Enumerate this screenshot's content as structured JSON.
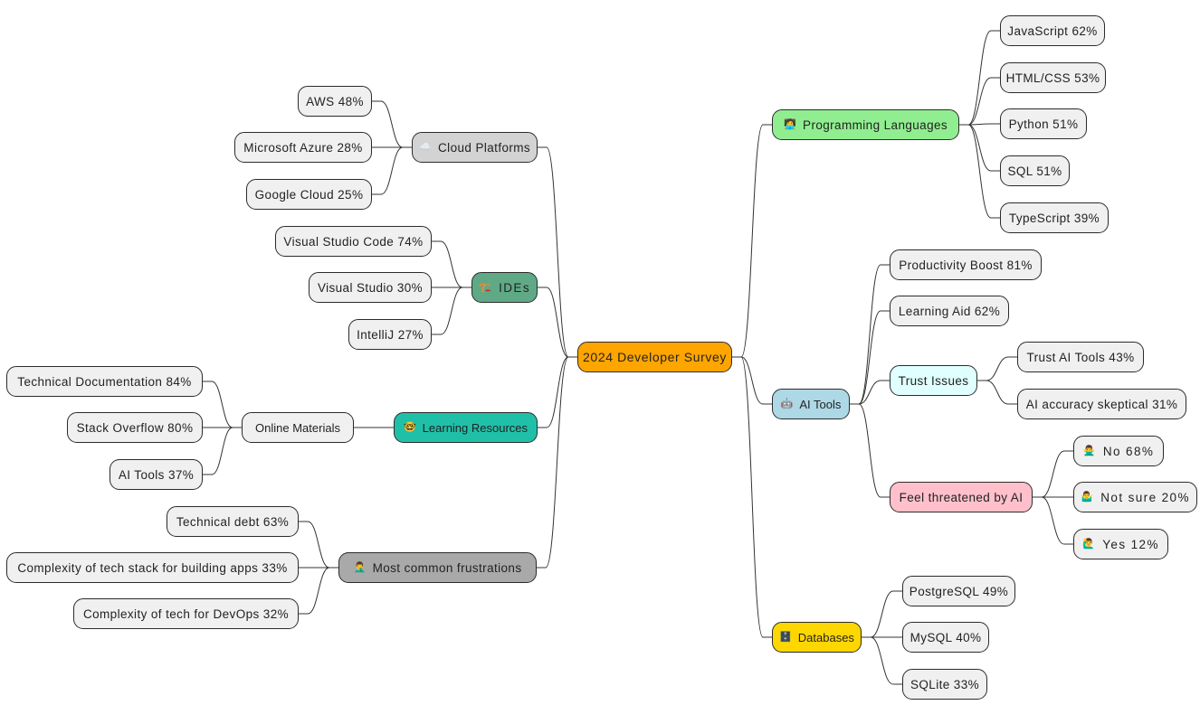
{
  "title": "2024 Developer Survey",
  "colors": {
    "root": "#ffa500",
    "programming_languages": "#90ee90",
    "ai_tools": "#add8e6",
    "databases": "#ffd700",
    "cloud_platforms": "#d3d3d3",
    "ides": "#5fa987",
    "learning_resources": "#20c0a8",
    "frustrations": "#a9a9a9",
    "trust_issues": "#e0ffff",
    "feel_threatened": "#ffc0cb",
    "leaf": "#f0f0f0",
    "edge": "#333333"
  },
  "nodes": {
    "root": {
      "label": "2024 Developer Survey"
    },
    "programming_languages": {
      "label": "Programming Languages",
      "icon": "technologist-icon"
    },
    "javascript": {
      "label": "JavaScript 62%"
    },
    "html_css": {
      "label": "HTML/CSS 53%"
    },
    "python": {
      "label": "Python 51%"
    },
    "sql": {
      "label": "SQL 51%"
    },
    "typescript": {
      "label": "TypeScript 39%"
    },
    "ai_tools": {
      "label": "AI Tools",
      "icon": "robot-icon"
    },
    "productivity_boost": {
      "label": "Productivity Boost 81%"
    },
    "learning_aid": {
      "label": "Learning Aid 62%"
    },
    "trust_issues": {
      "label": "Trust Issues"
    },
    "trust_ai_tools": {
      "label": "Trust AI Tools 43%"
    },
    "ai_accuracy_skeptical": {
      "label": "AI accuracy skeptical 31%"
    },
    "feel_threatened": {
      "label": "Feel threatened by AI"
    },
    "threat_no": {
      "label": "No 68%",
      "icon": "person-gesturing-no-icon"
    },
    "threat_not_sure": {
      "label": "Not sure 20%",
      "icon": "person-shrugging-icon"
    },
    "threat_yes": {
      "label": "Yes 12%",
      "icon": "person-raising-hand-icon"
    },
    "databases": {
      "label": "Databases",
      "icon": "database-icon"
    },
    "postgresql": {
      "label": "PostgreSQL 49%"
    },
    "mysql": {
      "label": "MySQL 40%"
    },
    "sqlite": {
      "label": "SQLite 33%"
    },
    "cloud_platforms": {
      "label": "Cloud Platforms",
      "icon": "cloud-icon"
    },
    "aws": {
      "label": "AWS 48%"
    },
    "azure": {
      "label": "Microsoft Azure 28%"
    },
    "google_cloud": {
      "label": "Google Cloud 25%"
    },
    "ides": {
      "label": "IDEs",
      "icon": "construction-icon"
    },
    "vscode": {
      "label": "Visual Studio Code 74%"
    },
    "visual_studio": {
      "label": "Visual Studio 30%"
    },
    "intellij": {
      "label": "IntelliJ 27%"
    },
    "learning_resources": {
      "label": "Learning Resources",
      "icon": "nerd-face-icon"
    },
    "online_materials": {
      "label": "Online Materials"
    },
    "tech_docs": {
      "label": "Technical Documentation 84%"
    },
    "stack_overflow": {
      "label": "Stack Overflow 80%"
    },
    "learn_ai_tools": {
      "label": "AI Tools 37%"
    },
    "frustrations": {
      "label": "Most common frustrations",
      "icon": "person-facepalming-icon"
    },
    "technical_debt": {
      "label": "Technical debt 63%"
    },
    "complexity_stack": {
      "label": "Complexity of tech stack for building apps 33%"
    },
    "complexity_devops": {
      "label": "Complexity of tech for DevOps 32%"
    }
  },
  "edges": [
    [
      "root",
      "programming_languages"
    ],
    [
      "root",
      "ai_tools"
    ],
    [
      "root",
      "databases"
    ],
    [
      "root",
      "cloud_platforms"
    ],
    [
      "root",
      "ides"
    ],
    [
      "root",
      "learning_resources"
    ],
    [
      "root",
      "frustrations"
    ],
    [
      "programming_languages",
      "javascript"
    ],
    [
      "programming_languages",
      "html_css"
    ],
    [
      "programming_languages",
      "python"
    ],
    [
      "programming_languages",
      "sql"
    ],
    [
      "programming_languages",
      "typescript"
    ],
    [
      "ai_tools",
      "productivity_boost"
    ],
    [
      "ai_tools",
      "learning_aid"
    ],
    [
      "ai_tools",
      "trust_issues"
    ],
    [
      "ai_tools",
      "feel_threatened"
    ],
    [
      "trust_issues",
      "trust_ai_tools"
    ],
    [
      "trust_issues",
      "ai_accuracy_skeptical"
    ],
    [
      "feel_threatened",
      "threat_no"
    ],
    [
      "feel_threatened",
      "threat_not_sure"
    ],
    [
      "feel_threatened",
      "threat_yes"
    ],
    [
      "databases",
      "postgresql"
    ],
    [
      "databases",
      "mysql"
    ],
    [
      "databases",
      "sqlite"
    ],
    [
      "cloud_platforms",
      "aws"
    ],
    [
      "cloud_platforms",
      "azure"
    ],
    [
      "cloud_platforms",
      "google_cloud"
    ],
    [
      "ides",
      "vscode"
    ],
    [
      "ides",
      "visual_studio"
    ],
    [
      "ides",
      "intellij"
    ],
    [
      "learning_resources",
      "online_materials"
    ],
    [
      "online_materials",
      "tech_docs"
    ],
    [
      "online_materials",
      "stack_overflow"
    ],
    [
      "online_materials",
      "learn_ai_tools"
    ],
    [
      "frustrations",
      "technical_debt"
    ],
    [
      "frustrations",
      "complexity_stack"
    ],
    [
      "frustrations",
      "complexity_devops"
    ]
  ]
}
